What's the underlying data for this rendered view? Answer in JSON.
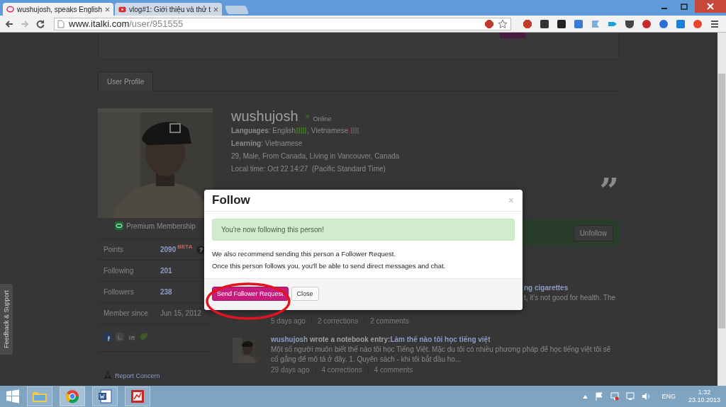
{
  "browser": {
    "tabs": [
      {
        "title": "wushujosh, speaks English",
        "selected": true
      },
      {
        "title": "vlog#1: Giới thiệu và thử t",
        "selected": false
      }
    ],
    "address": {
      "domain": "www.italki.com",
      "path": "/user/951555"
    }
  },
  "page": {
    "tabs": [
      {
        "label": "User Profile",
        "selected": true
      }
    ],
    "profile": {
      "badge": "Premium Membership",
      "stats": [
        {
          "label": "Points",
          "value": "2090",
          "link": true,
          "tag": "BETA",
          "help": "?"
        },
        {
          "label": "Following",
          "value": "201",
          "link": true
        },
        {
          "label": "Followers",
          "value": "238",
          "link": true
        },
        {
          "label": "Member since",
          "value": "Jun 15, 2012",
          "link": false
        }
      ],
      "report": "Report Concern"
    },
    "user": {
      "name": "wushujosh",
      "online": true,
      "status": "Online",
      "languages_label": "**Languages**:",
      "separator": ", ",
      "languages": [
        {
          "name": "English",
          "kind": "native",
          "level": 1
        },
        {
          "name": "Vietnamese",
          "kind": "learning",
          "level": 0.2
        }
      ],
      "learning_line": "**Learning**: Vietnamese",
      "details": "29, Male, From Canada, Living in Vancouver, Canada",
      "local_time": "Local time: Oct 22 14:27  (Pacific Standard Time)"
    },
    "quote_mark": "”",
    "unfollow": "Unfollow",
    "feed": [
      {
        "title": "ng cigarettes",
        "body": "t, it's not good for health. The",
        "meta": [
          "5 days ago",
          "2 corrections",
          "2 comments"
        ]
      },
      {
        "author": "wushujosh",
        "action": "wrote a notebook entry:",
        "title": "Làm thế nào tôi học tiếng việt",
        "body": "Một số người muôn biết thế nào tôi học Tiếng Việt. Mặc du tôi có nhiều phương pháp để học tiếng việt tôi sẽ cố gắng để mô tả ở đây. 1. Quyên sách - khi tôi bắt đầu ho...",
        "meta": [
          "29 days ago",
          "4 corrections",
          "4 comments"
        ]
      }
    ],
    "feedback": "Feedback & Support"
  },
  "modal": {
    "title": "Follow",
    "close": "×",
    "success": "You're now following this person!",
    "lines": [
      "We also recommend sending this person a Follower Request.",
      "Once this person follows you, you'll be able to send direct messages and chat."
    ],
    "primary": "Send Follower Request",
    "secondary": "Close"
  },
  "taskbar": {
    "language": "ENG",
    "time": "1:32",
    "date": "23.10.2013"
  }
}
